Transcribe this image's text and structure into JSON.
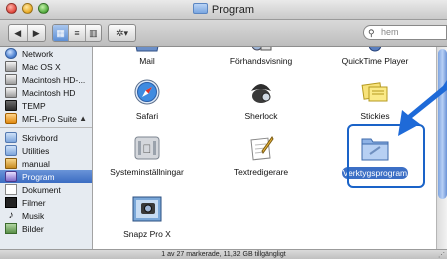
{
  "window": {
    "title": "Program",
    "search_placeholder": "hem",
    "status_text": "1 av 27 markerade, 11,32 GB tillgängligt"
  },
  "sidebar": {
    "items": [
      {
        "label": "Network",
        "icon": "globe-icon"
      },
      {
        "label": "Mac OS X",
        "icon": "disk-icon"
      },
      {
        "label": "Macintosh HD-...",
        "icon": "disk-icon"
      },
      {
        "label": "Macintosh HD",
        "icon": "disk-icon"
      },
      {
        "label": "TEMP",
        "icon": "disk-icon"
      },
      {
        "label": "MFL-Pro Suite",
        "icon": "mfl-icon",
        "eject": "▲"
      },
      {
        "label": "Skrivbord",
        "icon": "desktop-icon"
      },
      {
        "label": "Utilities",
        "icon": "folder-icon"
      },
      {
        "label": "manual",
        "icon": "home-icon"
      },
      {
        "label": "Program",
        "icon": "applications-icon",
        "selected": true
      },
      {
        "label": "Dokument",
        "icon": "document-icon"
      },
      {
        "label": "Filmer",
        "icon": "film-icon"
      },
      {
        "label": "Musik",
        "icon": "music-icon"
      },
      {
        "label": "Bilder",
        "icon": "pictures-icon"
      }
    ]
  },
  "items": [
    {
      "label": "Mail",
      "icon": "mail-icon"
    },
    {
      "label": "Förhandsvisning",
      "icon": "preview-icon"
    },
    {
      "label": "QuickTime Player",
      "icon": "quicktime-icon"
    },
    {
      "label": "Safari",
      "icon": "safari-icon"
    },
    {
      "label": "Sherlock",
      "icon": "sherlock-icon"
    },
    {
      "label": "Stickies",
      "icon": "stickies-icon"
    },
    {
      "label": "Systeminställningar",
      "icon": "system-preferences-icon"
    },
    {
      "label": "Textredigerare",
      "icon": "textedit-icon"
    },
    {
      "label": "Verktygsprogram",
      "icon": "utilities-folder-icon",
      "selected": true
    },
    {
      "label": "Snapz Pro X",
      "icon": "snapz-icon"
    }
  ],
  "colors": {
    "selection": "#3c6fc5",
    "highlight_border": "#1a63c8",
    "arrow": "#1e6ad8"
  }
}
